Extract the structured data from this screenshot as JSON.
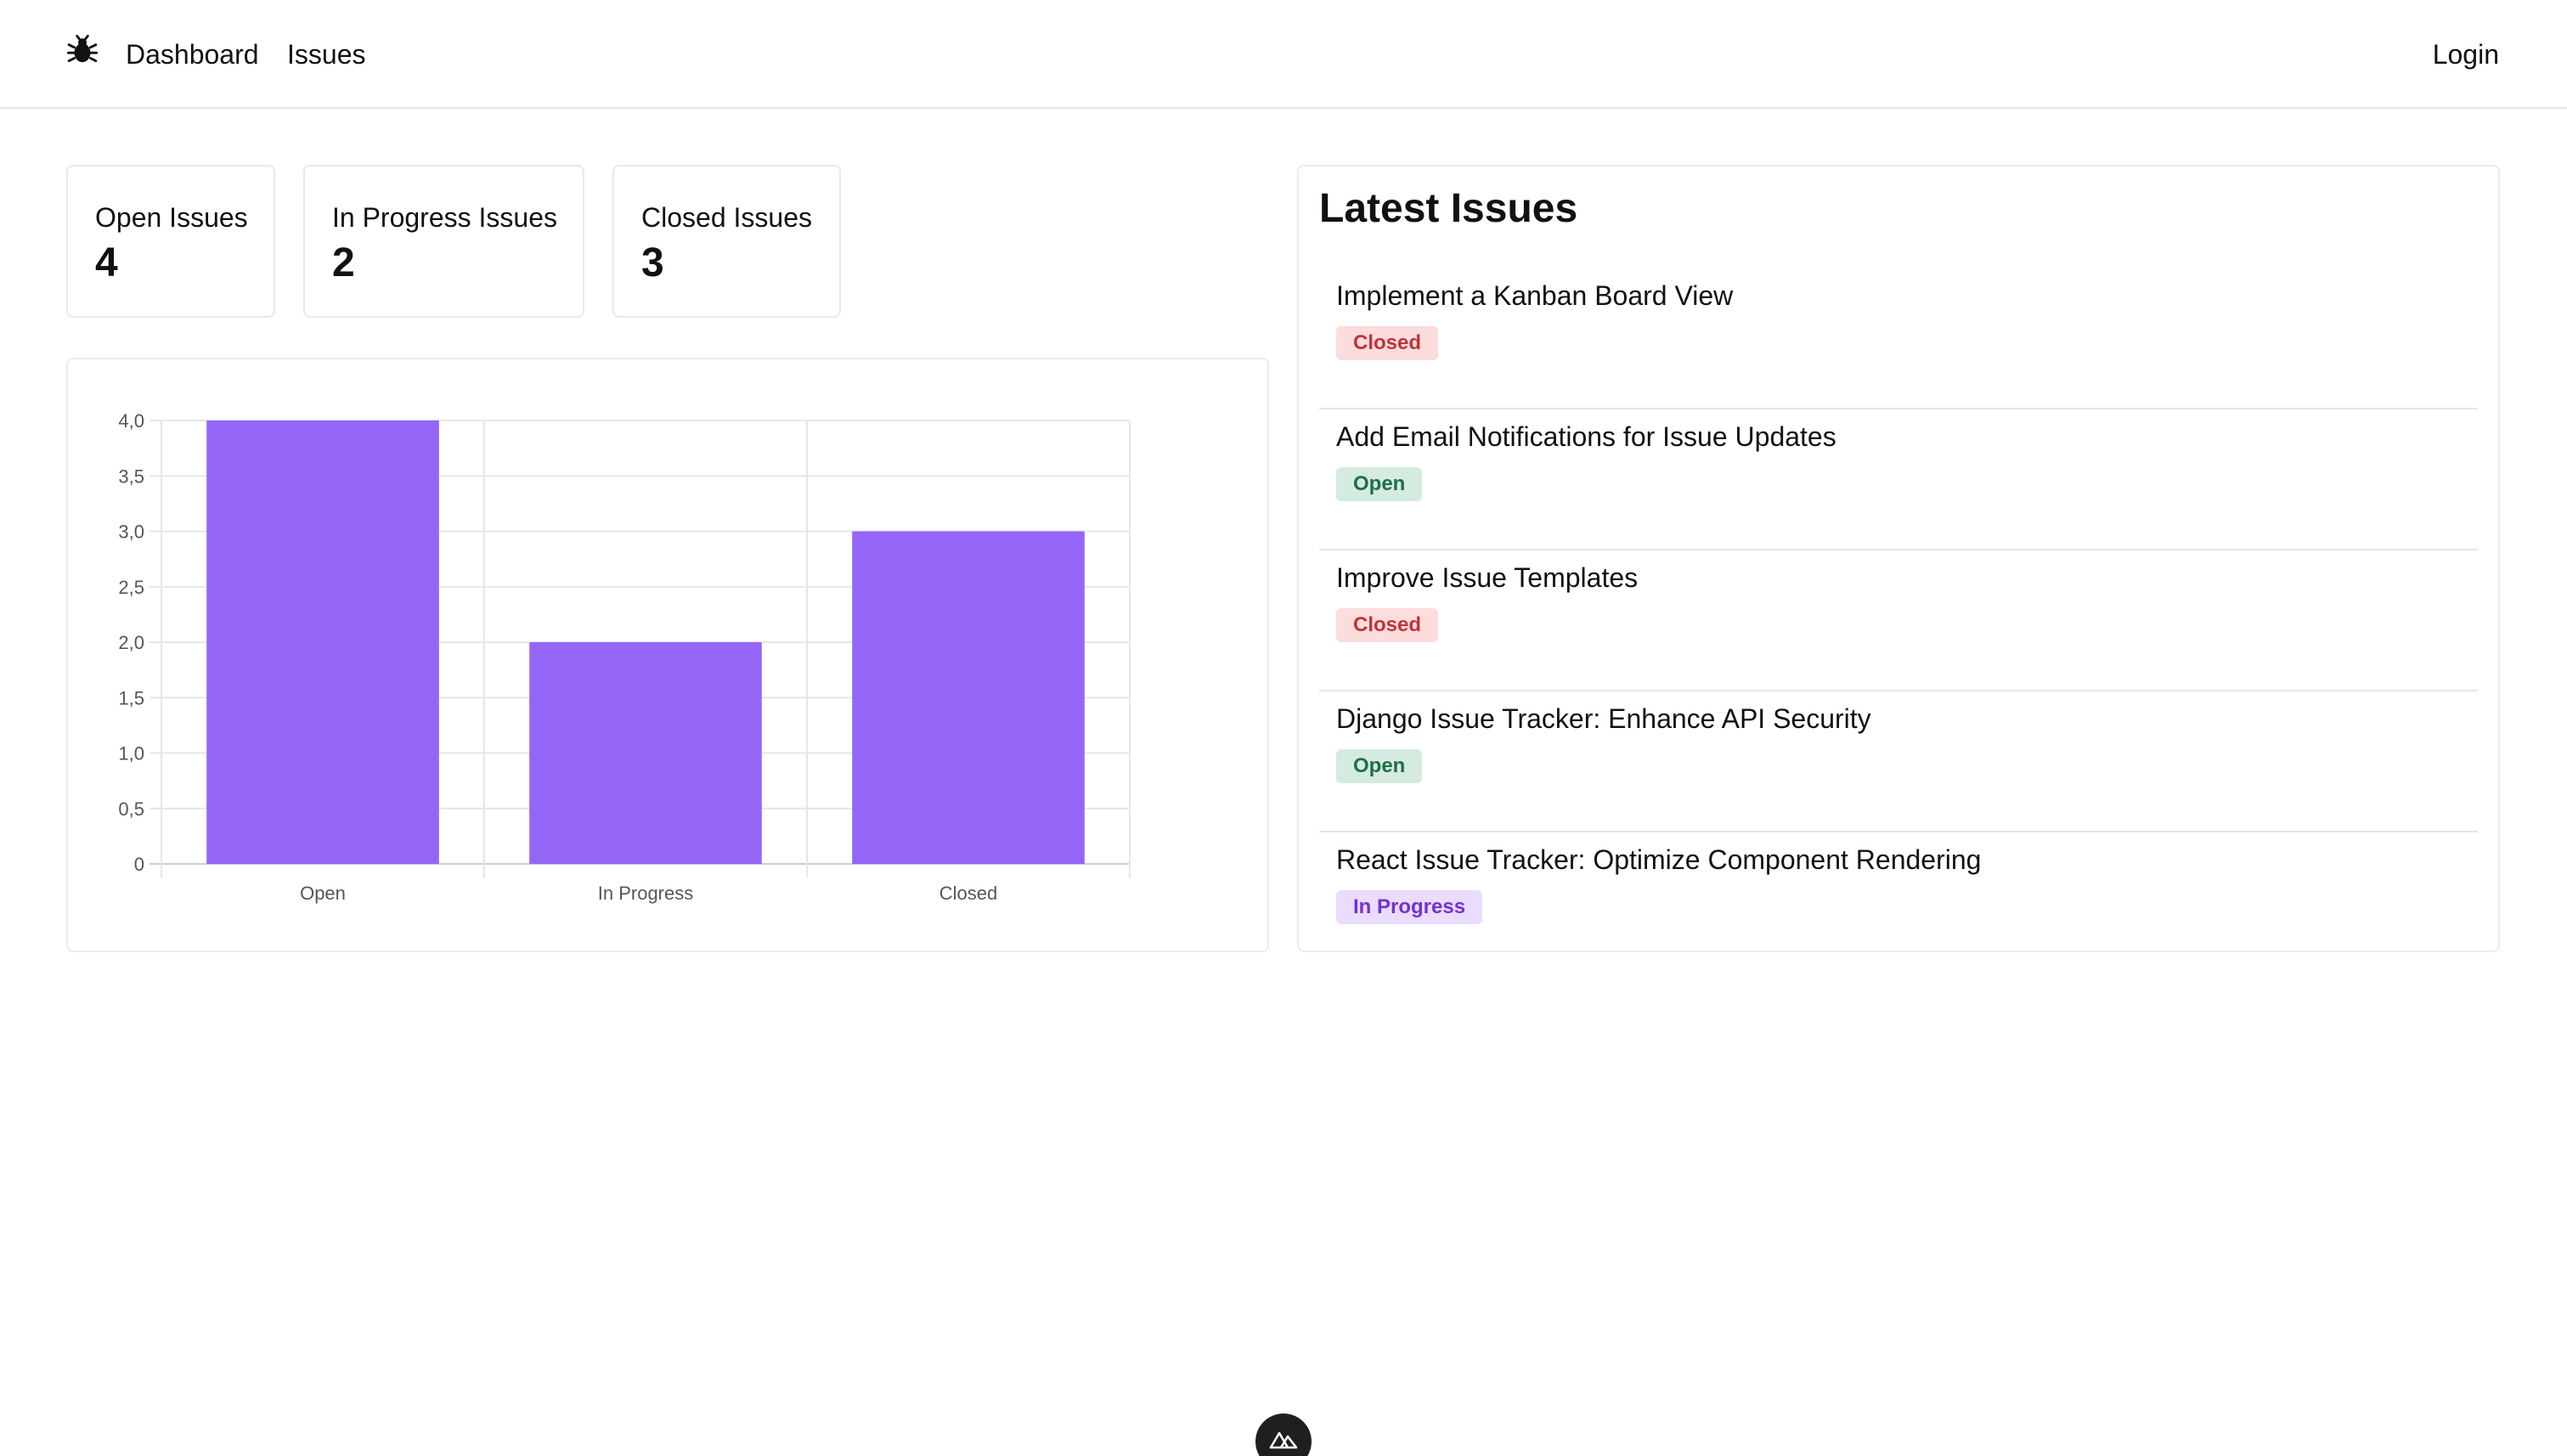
{
  "nav": {
    "logo_icon": "bug-icon",
    "links": [
      "Dashboard",
      "Issues"
    ],
    "login": "Login"
  },
  "stats": {
    "open": {
      "label": "Open Issues",
      "value": "4"
    },
    "in_progress": {
      "label": "In Progress Issues",
      "value": "2"
    },
    "closed": {
      "label": "Closed Issues",
      "value": "3"
    }
  },
  "chart_data": {
    "type": "bar",
    "categories": [
      "Open",
      "In Progress",
      "Closed"
    ],
    "values": [
      4,
      2,
      3
    ],
    "yticks": [
      "0",
      "0,5",
      "1,0",
      "1,5",
      "2,0",
      "2,5",
      "3,0",
      "3,5",
      "4,0"
    ],
    "ylim": [
      0,
      4
    ],
    "bar_color": "#9466f7",
    "grid": true
  },
  "latest": {
    "title": "Latest Issues",
    "issues": [
      {
        "title": "Implement a Kanban Board View",
        "status": "Closed"
      },
      {
        "title": "Add Email Notifications for Issue Updates",
        "status": "Open"
      },
      {
        "title": "Improve Issue Templates",
        "status": "Closed"
      },
      {
        "title": "Django Issue Tracker: Enhance API Security",
        "status": "Open"
      },
      {
        "title": "React Issue Tracker: Optimize Component Rendering",
        "status": "In Progress"
      }
    ]
  },
  "footer": {
    "icon": "nuxt-logo-icon"
  }
}
